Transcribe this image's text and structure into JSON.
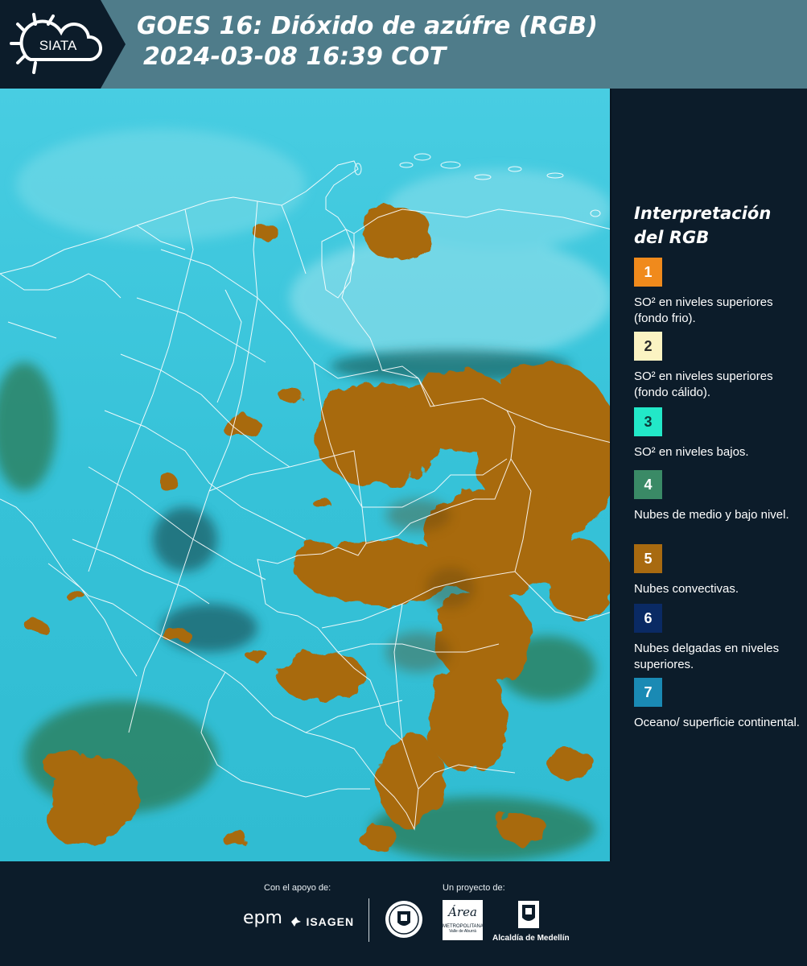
{
  "header": {
    "logo_text": "SIATA",
    "title_line1": "GOES 16: Dióxido de azúfre (RGB)",
    "title_line2": "2024-03-08 16:39 COT"
  },
  "legend": {
    "title": "Interpretación del RGB",
    "items": [
      {
        "number": "1",
        "color": "#f08a1c",
        "text_color": "#ffffff",
        "label": "SO² en niveles superiores (fondo frio)."
      },
      {
        "number": "2",
        "color": "#fbf3c2",
        "text_color": "#2a2a2a",
        "label": "SO² en niveles superiores (fondo cálido)."
      },
      {
        "number": "3",
        "color": "#22e8c8",
        "text_color": "#0c3a3a",
        "label": "SO² en niveles bajos."
      },
      {
        "number": "4",
        "color": "#3a8a66",
        "text_color": "#ffffff",
        "label": "Nubes de medio y bajo nivel."
      },
      {
        "number": "5",
        "color": "#a86a10",
        "text_color": "#ffffff",
        "label": "Nubes convectivas."
      },
      {
        "number": "6",
        "color": "#0a2a64",
        "text_color": "#ffffff",
        "label": "Nubes delgadas en niveles superiores."
      },
      {
        "number": "7",
        "color": "#1a8ab4",
        "text_color": "#ffffff",
        "label": "Oceano/ superficie continental."
      }
    ]
  },
  "footer": {
    "support_label": "Con el apoyo de:",
    "project_label": "Un proyecto de:",
    "epm": "epm",
    "isagen": "ISAGEN",
    "area_metropolitana": "Área",
    "area_sub": "METROPOLITANA",
    "area_sub2": "Valle de Aburrá",
    "alcaldia": "Alcaldía de Medellín"
  },
  "map": {
    "background_color": "#3cc8dc",
    "cloud_color": "#a86a10",
    "border_color": "#ffffff"
  }
}
